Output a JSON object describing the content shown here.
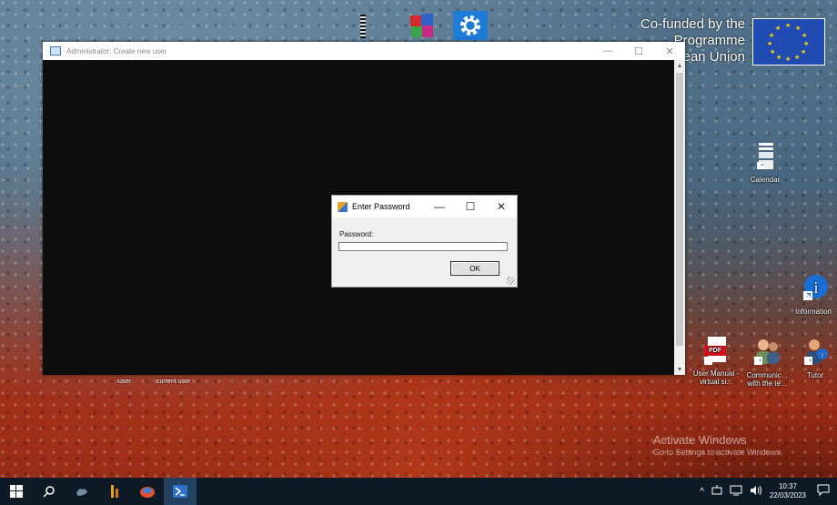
{
  "eu_banner": {
    "lines": [
      "Co-funded by the",
      "Programme",
      "ean Union"
    ]
  },
  "main_window": {
    "title": "Administrator: Create new user",
    "minimize": "—",
    "maximize": "☐",
    "close": "✕"
  },
  "dialog": {
    "title": "Enter Password",
    "minimize": "—",
    "maximize": "☐",
    "close": "✕",
    "password_label": "Password:",
    "password_value": "",
    "ok_label": "OK"
  },
  "desktop_icons": {
    "calendar": "Calendar",
    "information": "Information",
    "user_manual": "User Manual - virtual si...",
    "communic": "Communic... with the te...",
    "tutor": "Tutor",
    "pdf_badge": "PDF"
  },
  "behind_labels": {
    "left": "user",
    "right": "current user"
  },
  "activate": {
    "title": "Activate Windows",
    "subtitle": "Go to Settings to activate Windows."
  },
  "taskbar": {
    "time": "10:37",
    "date": "22/03/2023"
  },
  "colors": {
    "taskbar": "#0e1a26",
    "eu_flag": "#1f4bb2",
    "gear_tile": "#1e7bd6"
  }
}
